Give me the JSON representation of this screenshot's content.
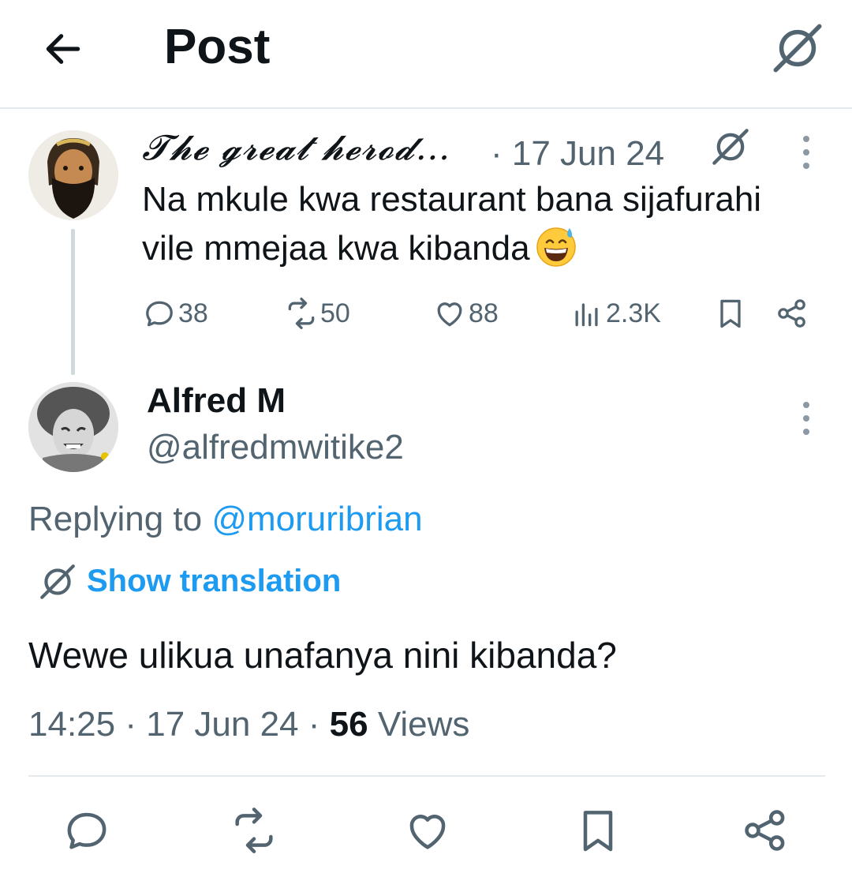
{
  "header": {
    "title": "Post"
  },
  "parent_tweet": {
    "display_name": "𝓣𝓱𝓮 𝓰𝓻𝓮𝓪𝓽 𝓱𝓮𝓻𝓸𝓭…",
    "meta": "· 17 Jun 24",
    "text": "Na mkule kwa restaurant bana sijafurahi vile mmejaa kwa kibanda",
    "emoji": "grinning-face-with-sweat",
    "stats": {
      "replies": "38",
      "reposts": "50",
      "likes": "88",
      "views": "2.3K"
    }
  },
  "main_tweet": {
    "display_name": "Alfred M",
    "handle": "@alfredmwitike2",
    "replying_to_label": "Replying to ",
    "replying_to_handle": "@moruribrian",
    "show_translation": "Show translation",
    "text": "Wewe ulikua unafanya nini kibanda?",
    "time": "14:25",
    "date": "17 Jun 24",
    "views_count": "56",
    "views_label": "Views"
  },
  "icons": {
    "back": "arrow-left-icon",
    "grok": "grok-icon",
    "more": "more-vertical-icon",
    "reply": "reply-icon",
    "repost": "repost-icon",
    "like": "heart-icon",
    "views": "views-icon",
    "bookmark": "bookmark-icon",
    "share": "share-icon"
  },
  "colors": {
    "accent": "#1d9bf0",
    "text": "#0f1419",
    "secondary": "#536471",
    "divider": "#e6e9eb"
  }
}
